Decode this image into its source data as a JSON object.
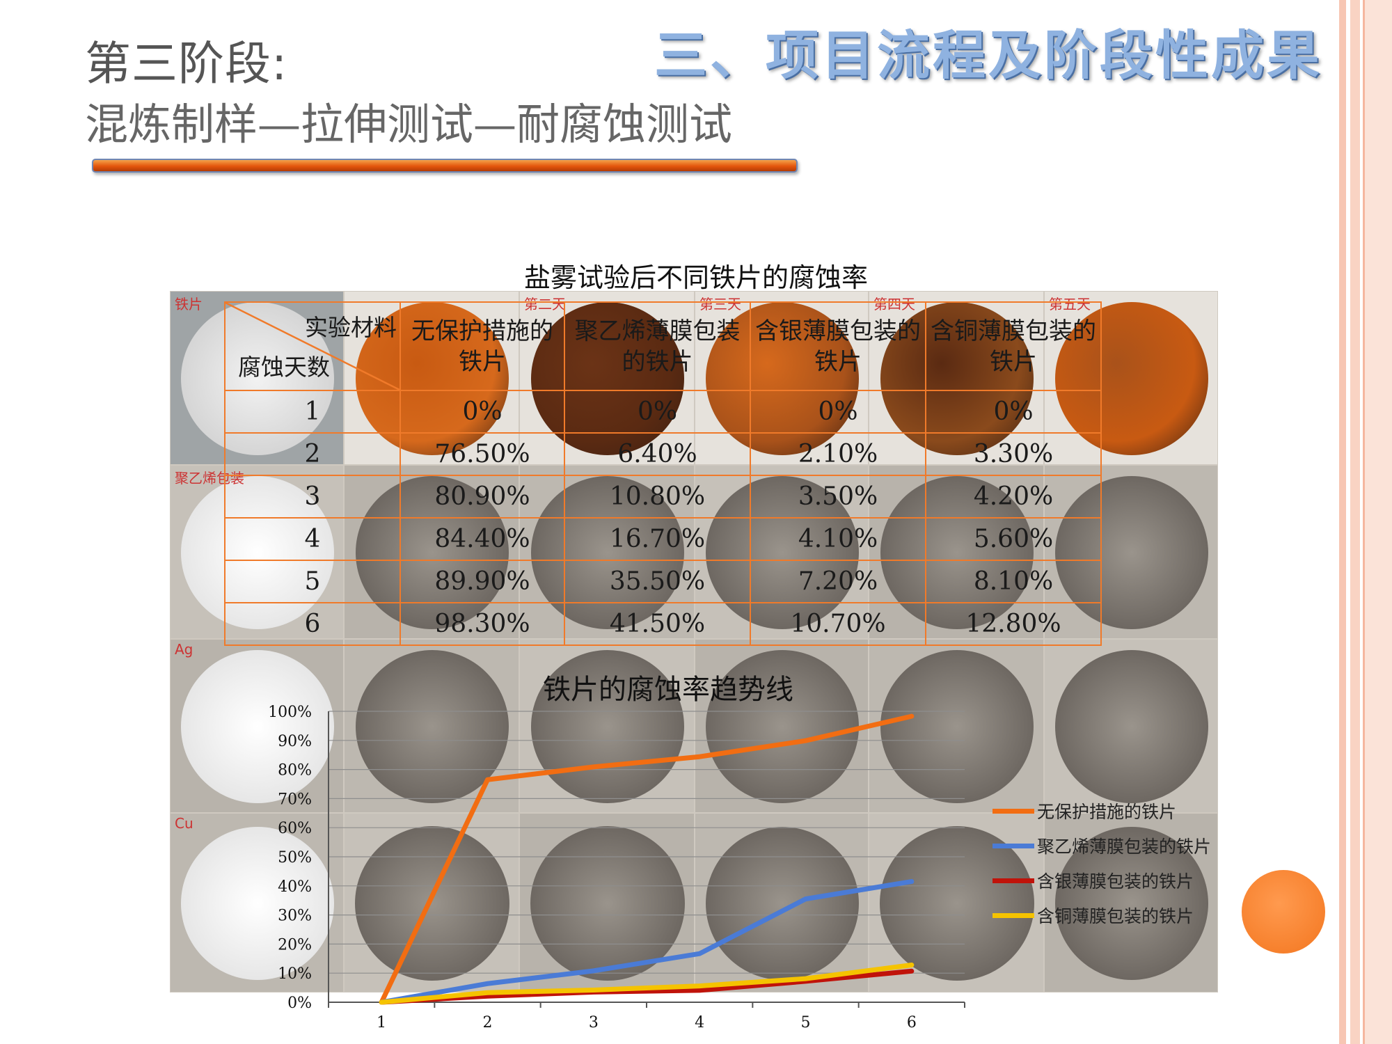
{
  "header": {
    "stage_title": "第三阶段:",
    "stage_subtitle": "混炼制样—拉伸测试—耐腐蚀测试",
    "section_title": "三、项目流程及阶段性成果"
  },
  "photo_labels": {
    "tile_1": "铁片",
    "tile_3": "第二天",
    "tile_4": "第三天",
    "tile_5": "第四天",
    "tile_6": "第五天",
    "tile_7": "聚乙烯包装",
    "tile_13": "Ag",
    "tile_19": "Cu"
  },
  "table": {
    "title": "盐雾试验后不同铁片的腐蚀率",
    "corner_top": "实验材料",
    "corner_bottom": "腐蚀天数",
    "columns": [
      "无保护措施的铁片",
      "聚乙烯薄膜包装的铁片",
      "含银薄膜包装的铁片",
      "含铜薄膜包装的铁片"
    ],
    "rows": [
      {
        "day": "1",
        "values": [
          "0%",
          "0%",
          "0%",
          "0%"
        ]
      },
      {
        "day": "2",
        "values": [
          "76.50%",
          "6.40%",
          "2.10%",
          "3.30%"
        ]
      },
      {
        "day": "3",
        "values": [
          "80.90%",
          "10.80%",
          "3.50%",
          "4.20%"
        ]
      },
      {
        "day": "4",
        "values": [
          "84.40%",
          "16.70%",
          "4.10%",
          "5.60%"
        ]
      },
      {
        "day": "5",
        "values": [
          "89.90%",
          "35.50%",
          "7.20%",
          "8.10%"
        ]
      },
      {
        "day": "6",
        "values": [
          "98.30%",
          "41.50%",
          "10.70%",
          "12.80%"
        ]
      }
    ]
  },
  "chart_data": {
    "type": "line",
    "title": "铁片的腐蚀率趋势线",
    "categories": [
      "1",
      "2",
      "3",
      "4",
      "5",
      "6"
    ],
    "ylim": [
      0,
      100
    ],
    "yticks": [
      "0%",
      "10%",
      "20%",
      "30%",
      "40%",
      "50%",
      "60%",
      "70%",
      "80%",
      "90%",
      "100%"
    ],
    "legend_position": "right",
    "series": [
      {
        "name": "无保护措施的铁片",
        "color": "#f26d12",
        "values": [
          0,
          76.5,
          80.9,
          84.4,
          89.9,
          98.3
        ]
      },
      {
        "name": "聚乙烯薄膜包装的铁片",
        "color": "#4a7bd6",
        "values": [
          0,
          6.4,
          10.8,
          16.7,
          35.5,
          41.5
        ]
      },
      {
        "name": "含银薄膜包装的铁片",
        "color": "#c0130a",
        "values": [
          0,
          2.1,
          3.5,
          4.1,
          7.2,
          10.7
        ]
      },
      {
        "name": "含铜薄膜包装的铁片",
        "color": "#f5c300",
        "values": [
          0,
          3.3,
          4.2,
          5.6,
          8.1,
          12.8
        ]
      }
    ]
  },
  "colors": {
    "accent_orange": "#f3761f",
    "title_blue": "#8fb2e0",
    "stripe_pink": "#f9d3c3"
  }
}
